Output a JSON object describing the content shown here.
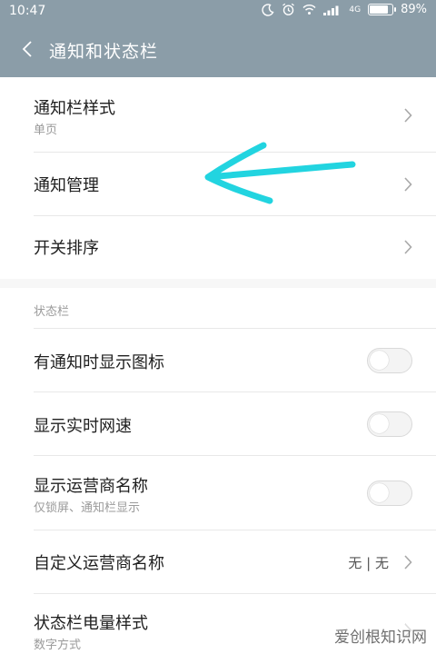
{
  "status_bar": {
    "time": "10:47",
    "network": "4G",
    "battery": "89%",
    "battery_level": 0.89
  },
  "header": {
    "title": "通知和状态栏",
    "back_icon": "chevron-left-icon"
  },
  "notification_group": {
    "items": [
      {
        "title": "通知栏样式",
        "subtitle": "单页"
      },
      {
        "title": "通知管理"
      },
      {
        "title": "开关排序"
      }
    ]
  },
  "statusbar_group": {
    "section_label": "状态栏",
    "items": [
      {
        "title": "有通知时显示图标",
        "toggle_on": false
      },
      {
        "title": "显示实时网速",
        "toggle_on": false
      },
      {
        "title": "显示运营商名称",
        "subtitle": "仅锁屏、通知栏显示",
        "toggle_on": false
      },
      {
        "title": "自定义运营商名称",
        "value": "无 | 无"
      },
      {
        "title": "状态栏电量样式",
        "subtitle": "数字方式"
      }
    ]
  },
  "annotation": {
    "arrow_color": "#22d4e0"
  },
  "watermark": "爱创根知识网",
  "colors": {
    "header_bg": "#8b9da8",
    "page_bg": "#f7f7f7",
    "row_bg": "#ffffff"
  }
}
